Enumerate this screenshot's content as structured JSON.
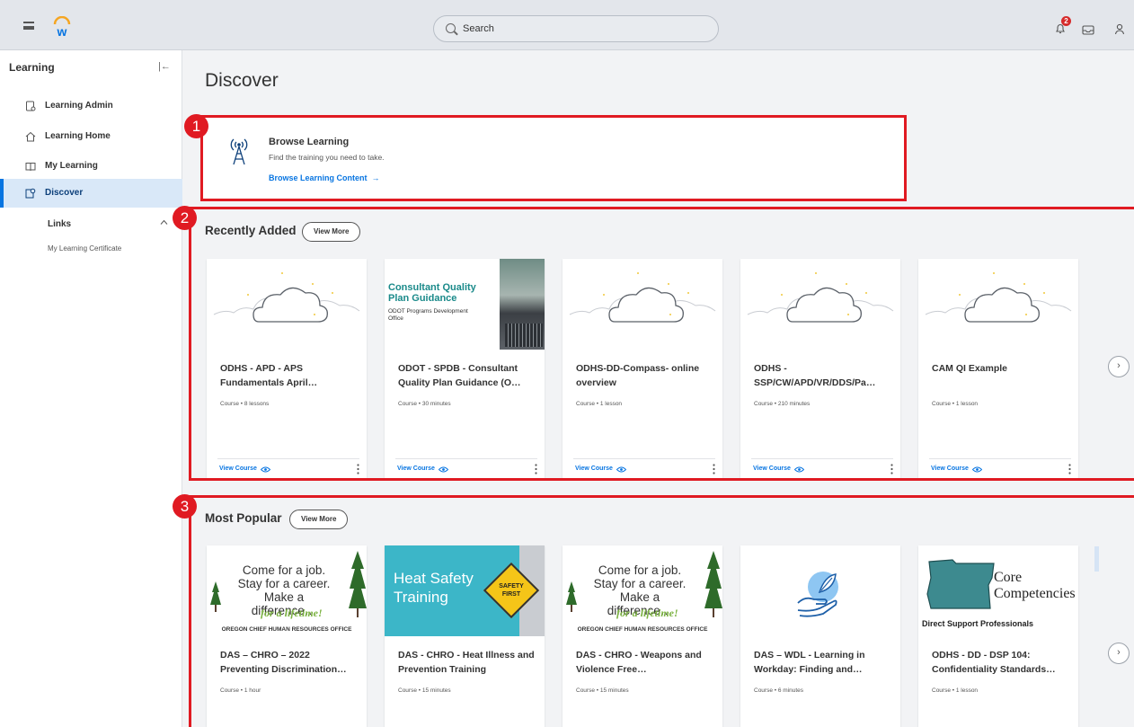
{
  "header": {
    "search_placeholder": "Search",
    "notification_count": "2"
  },
  "sidebar": {
    "title": "Learning",
    "items": [
      {
        "label": "Learning Admin",
        "icon": "admin-icon"
      },
      {
        "label": "Learning Home",
        "icon": "home-icon"
      },
      {
        "label": "My Learning",
        "icon": "book-icon"
      },
      {
        "label": "Discover",
        "icon": "discover-icon",
        "active": true
      }
    ],
    "links_header": "Links",
    "links": [
      "My Learning Certificate"
    ]
  },
  "main": {
    "title": "Discover",
    "browse": {
      "title": "Browse Learning",
      "subtitle": "Find the training you need to take.",
      "link": "Browse Learning Content"
    },
    "recently_added": {
      "title": "Recently Added",
      "view_more": "View More",
      "cards": [
        {
          "title": "ODHS - APD - APS Fundamentals April…",
          "meta": "Course • 8 lessons",
          "thumb": "cloud",
          "action": "View Course"
        },
        {
          "title": "ODOT - SPDB - Consultant Quality Plan Guidance (O…",
          "meta": "Course • 30 minutes",
          "thumb": "consultant",
          "thumb_text": [
            "Consultant Quality",
            "Plan Guidance",
            "ODOT Programs Development",
            "Office"
          ],
          "action": "View Course"
        },
        {
          "title": "ODHS-DD-Compass- online overview",
          "meta": "Course • 1 lesson",
          "thumb": "cloud",
          "action": "View Course"
        },
        {
          "title": "ODHS - SSP/CW/APD/VR/DDS/Pa…",
          "meta": "Course • 210 minutes",
          "thumb": "cloud",
          "action": "View Course"
        },
        {
          "title": "CAM QI Example",
          "meta": "Course • 1 lesson",
          "thumb": "cloud",
          "action": "View Course"
        }
      ]
    },
    "most_popular": {
      "title": "Most Popular",
      "view_more": "View More",
      "cards": [
        {
          "title": "DAS – CHRO – 2022 Preventing Discrimination…",
          "meta": "Course • 1 hour",
          "thumb": "career",
          "thumb_text": [
            "Come for a job.",
            "Stay for a career.",
            "Make a difference…",
            "for a lifetime!",
            "OREGON CHIEF HUMAN RESOURCES OFFICE"
          ]
        },
        {
          "title": "DAS - CHRO - Heat Illness and Prevention Training",
          "meta": "Course • 15 minutes",
          "thumb": "heat",
          "thumb_text": [
            "Heat Safety",
            "Training",
            "SAFETY",
            "FIRST"
          ]
        },
        {
          "title": "DAS - CHRO - Weapons and Violence Free…",
          "meta": "Course • 15 minutes",
          "thumb": "career",
          "thumb_text": [
            "Come for a job.",
            "Stay for a career.",
            "Make a difference…",
            "for a lifetime!",
            "OREGON CHIEF HUMAN RESOURCES OFFICE"
          ]
        },
        {
          "title": "DAS – WDL - Learning in Workday: Finding and…",
          "meta": "Course • 6 minutes",
          "thumb": "hand"
        },
        {
          "title": "ODHS - DD - DSP 104: Confidentiality Standards…",
          "meta": "Course • 1 lesson",
          "thumb": "oregon",
          "thumb_text": [
            "Core",
            "Competencies",
            "Direct Support Professionals"
          ]
        }
      ]
    }
  },
  "annotations": [
    "1",
    "2",
    "3"
  ],
  "colors": {
    "accent": "#0875e1",
    "highlight": "#e01a22",
    "active_bg": "#d9e8f8"
  }
}
